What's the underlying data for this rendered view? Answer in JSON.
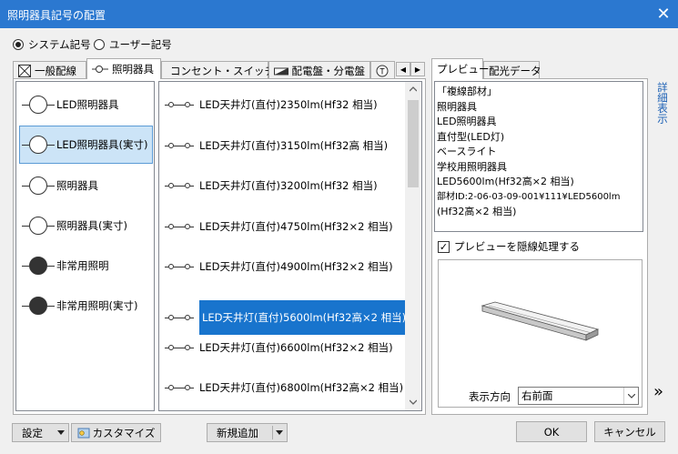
{
  "window": {
    "title": "照明器具記号の配置",
    "close_glyph": "✕"
  },
  "symbol_mode": {
    "options": [
      "システム記号",
      "ユーザー記号"
    ],
    "selected": 0
  },
  "tabs": [
    {
      "label": "一般配線",
      "icon": "box-x-icon"
    },
    {
      "label": "照明器具",
      "icon": "light-icon"
    },
    {
      "label": "コンセント・スイッチ",
      "icon": "outlet-icon"
    },
    {
      "label": "配電盤・分電盤",
      "icon": "panel-icon"
    }
  ],
  "tab_scroll": {
    "prev": "◀",
    "next": "▶"
  },
  "categories": [
    {
      "label": "LED照明器具",
      "filled": false
    },
    {
      "label": "LED照明器具(実寸)",
      "filled": false,
      "selected": true
    },
    {
      "label": "照明器具",
      "filled": false
    },
    {
      "label": "照明器具(実寸)",
      "filled": false
    },
    {
      "label": "非常用照明",
      "filled": true
    },
    {
      "label": "非常用照明(実寸)",
      "filled": true
    }
  ],
  "fixtures": [
    "LED天井灯(直付)2350lm(Hf32 相当)",
    "LED天井灯(直付)3150lm(Hf32高 相当)",
    "LED天井灯(直付)3200lm(Hf32 相当)",
    "LED天井灯(直付)4750lm(Hf32×2 相当)",
    "LED天井灯(直付)4900lm(Hf32×2 相当)",
    "LED天井灯(直付)5600lm(Hf32高×2 相当)",
    "LED天井灯(直付)6600lm(Hf32×2 相当)",
    "LED天井灯(直付)6800lm(Hf32高×2 相当)"
  ],
  "selected_fixture": 5,
  "preview_tabs": [
    "プレビュー",
    "配光データ"
  ],
  "preview_text": [
    "「複線部材」",
    "照明器具",
    "LED照明器具",
    "直付型(LED灯)",
    "ベースライト",
    "学校用照明器具",
    "LED5600lm(Hf32高×2 相当)",
    "部材ID:2-06-03-09-001¥111¥LED5600lm",
    "(Hf32高×2 相当)"
  ],
  "side_link": "詳細表示",
  "hidden_line_label": "プレビューを隠線処理する",
  "hidden_line_checked": true,
  "view_direction": {
    "label": "表示方向",
    "value": "右前面"
  },
  "expand_glyph": "»",
  "buttons": {
    "settings": "設定",
    "customize": "カスタマイズ",
    "add_new": "新規追加",
    "ok": "OK",
    "cancel": "キャンセル"
  }
}
